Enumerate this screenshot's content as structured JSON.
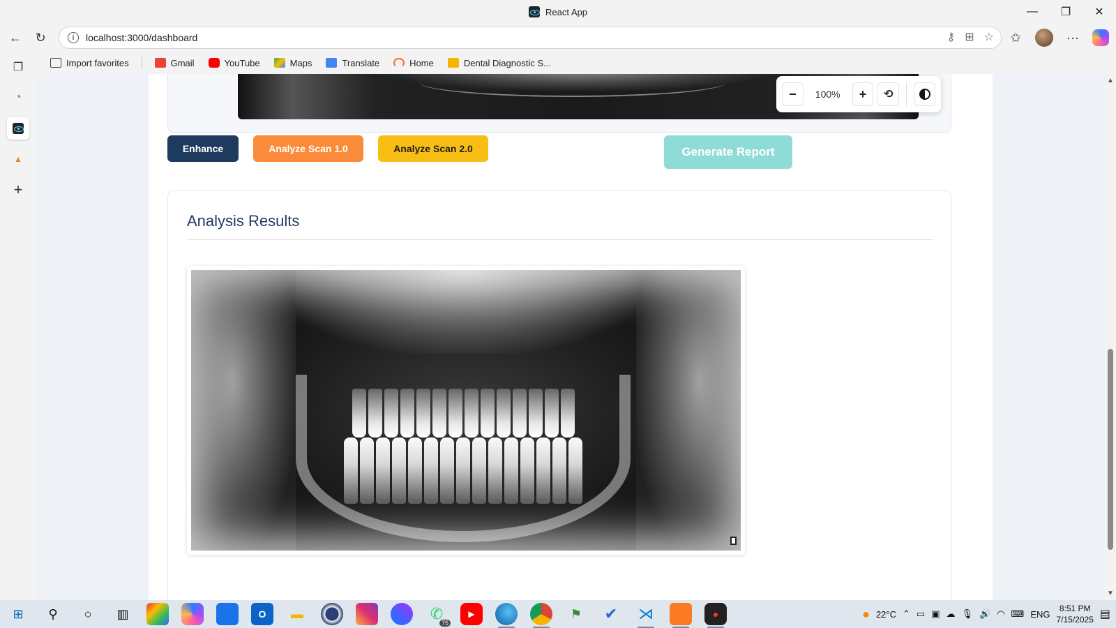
{
  "window": {
    "title": "React App",
    "minimize": "—",
    "maximize": "❐",
    "close": "✕"
  },
  "nav": {
    "url": "localhost:3000/dashboard",
    "back": "←",
    "reload": "↻",
    "more": "···"
  },
  "favorites": [
    {
      "label": "Import favorites",
      "color": "#ffffff"
    },
    {
      "label": "Gmail",
      "color": "#ea4335"
    },
    {
      "label": "YouTube",
      "color": "#ff0000"
    },
    {
      "label": "Maps",
      "color": "#34a853"
    },
    {
      "label": "Translate",
      "color": "#4285f4"
    },
    {
      "label": "Home",
      "color": "#f2711c"
    },
    {
      "label": "Dental Diagnostic S...",
      "color": "#f4b400"
    }
  ],
  "viewer": {
    "zoom_out": "−",
    "zoom_level": "100%",
    "zoom_in": "+",
    "reset": "⟲"
  },
  "actions": {
    "enhance": "Enhance",
    "analyze1": "Analyze Scan 1.0",
    "analyze2": "Analyze Scan 2.0",
    "report": "Generate Report"
  },
  "results": {
    "title": "Analysis Results"
  },
  "taskbar": {
    "whatsapp_badge": "75",
    "weather": "22°C",
    "lang": "ENG",
    "time": "8:51 PM",
    "date": "7/15/2025"
  },
  "colors": {
    "enhance": "#1e3a5f",
    "analyze1": "#f98b3a",
    "analyze2": "#f9be14",
    "report": "#8fdcd6",
    "title": "#1e3a5f"
  }
}
